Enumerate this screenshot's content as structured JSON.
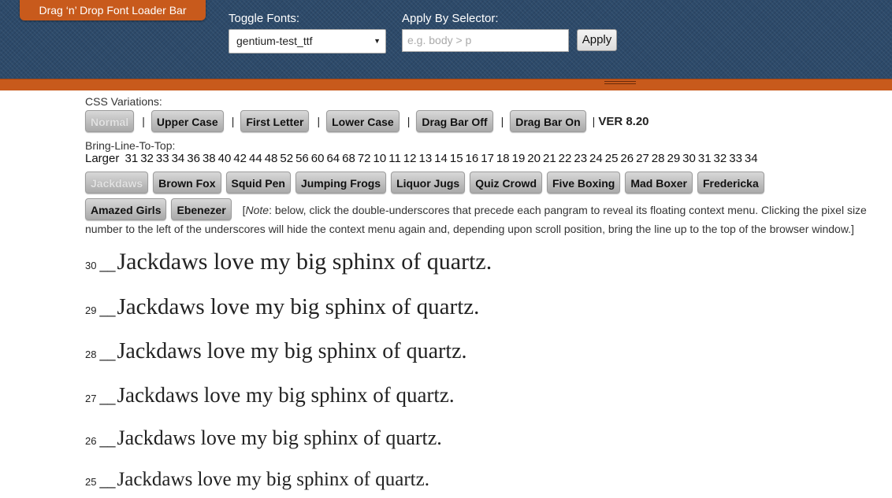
{
  "topbar": {
    "title": "Drag ‘n’ Drop Font Loader Bar",
    "toggle_fonts_label": "Toggle Fonts:",
    "selected_font": "gentium-test_ttf",
    "apply_selector_label": "Apply By Selector:",
    "selector_placeholder": "e.g. body > p",
    "apply_button": "Apply"
  },
  "css_variations": {
    "label": "CSS Variations:",
    "buttons": [
      "Normal",
      "Upper Case",
      "First Letter",
      "Lower Case",
      "Drag Bar Off",
      "Drag Bar On"
    ],
    "separator": "|",
    "version": "VER 8.20"
  },
  "bring_line": {
    "label": "Bring-Line-To-Top:",
    "larger": "Larger",
    "sizes": [
      "31",
      "32",
      "33",
      "34",
      "36",
      "38",
      "40",
      "42",
      "44",
      "48",
      "52",
      "56",
      "60",
      "64",
      "68",
      "72",
      "10",
      "11",
      "12",
      "13",
      "14",
      "15",
      "16",
      "17",
      "18",
      "19",
      "20",
      "21",
      "22",
      "23",
      "24",
      "25",
      "26",
      "27",
      "28",
      "29",
      "30",
      "31",
      "32",
      "33",
      "34"
    ]
  },
  "pangram_buttons": [
    "Jackdaws",
    "Brown Fox",
    "Squid Pen",
    "Jumping Frogs",
    "Liquor Jugs",
    "Quiz Crowd",
    "Five Boxing",
    "Mad Boxer",
    "Fredericka",
    "Amazed Girls",
    "Ebenezer"
  ],
  "note": {
    "open_bracket": "[",
    "note_word": "Note",
    "text": ": below, click the double-underscores that precede each pangram to reveal its floating context menu. Clicking the pixel size number to the left of the underscores will hide the context menu again and, depending upon scroll position, bring the line up to the top of the browser window.]"
  },
  "pangrams": [
    {
      "size": "30",
      "underscore": "__",
      "text": "Jackdaws love my big sphinx of quartz."
    },
    {
      "size": "29",
      "underscore": "__",
      "text": "Jackdaws love my big sphinx of quartz."
    },
    {
      "size": "28",
      "underscore": "__",
      "text": "Jackdaws love my big sphinx of quartz."
    },
    {
      "size": "27",
      "underscore": "__",
      "text": "Jackdaws love my big sphinx of quartz."
    },
    {
      "size": "26",
      "underscore": "__",
      "text": "Jackdaws love my big sphinx of quartz."
    },
    {
      "size": "25",
      "underscore": "__",
      "text": "Jackdaws love my big sphinx of quartz."
    }
  ],
  "colors": {
    "bar_bg": "#2d4a6a",
    "accent_orange": "#c85a1c"
  },
  "icons": {
    "dropdown": "chevron-down-icon",
    "grip": "drag-grip-icon"
  }
}
